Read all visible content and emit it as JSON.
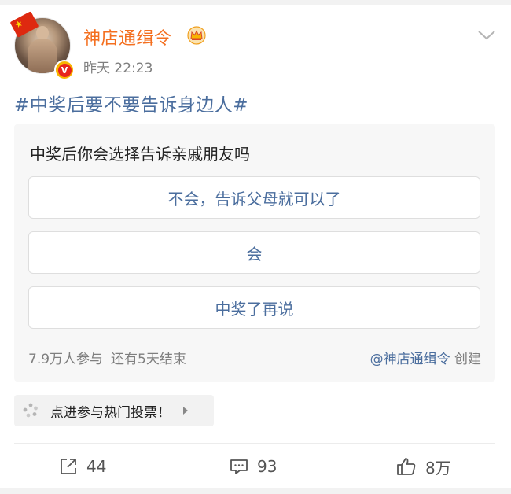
{
  "post": {
    "username": "神店通缉令",
    "timestamp": "昨天 22:23",
    "verify_badge": "V",
    "topic": "#中奖后要不要告诉身边人#",
    "accent_color": "#f46f1f",
    "link_color": "#4b6e9e"
  },
  "poll": {
    "question": "中奖后你会选择告诉亲戚朋友吗",
    "options": [
      {
        "label": "不会，告诉父母就可以了"
      },
      {
        "label": "会"
      },
      {
        "label": "中奖了再说"
      }
    ],
    "participants": "7.9万人参与",
    "remaining": "还有5天结束",
    "creator_mention": "@神店通缉令",
    "creator_suffix": "创建"
  },
  "hot_vote": {
    "label": "点进参与热门投票！",
    "icon": "vote-icon"
  },
  "actions": {
    "share_count": "44",
    "comment_count": "93",
    "like_count": "8万"
  },
  "icons": {
    "share": "share-icon",
    "comment": "comment-icon",
    "like": "thumbs-up-icon",
    "more": "chevron-down-icon",
    "crown": "crown-icon"
  }
}
